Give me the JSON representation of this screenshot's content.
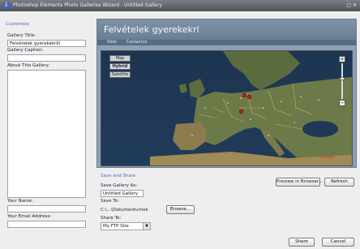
{
  "window": {
    "title": "Photoshop Elements Photo Galleries Wizard - Untitled Gallery"
  },
  "left_panel": {
    "section": "Customize",
    "gallery_title_label": "Gallery Title:",
    "gallery_title_value": "Felvételek gyerekekről",
    "gallery_caption_label": "Gallery Caption:",
    "about_label": "About This Gallery:",
    "your_name_label": "Your Name:",
    "email_label": "Your Email Address:"
  },
  "preview": {
    "gallery_title": "Felvételek gyerekekrl",
    "menu": [
      "View",
      "Contactus"
    ],
    "map_types": [
      "Map",
      "Hybrid",
      "Satellite"
    ]
  },
  "save_share": {
    "section": "Save and Share",
    "save_as_label": "Save Gallery As:",
    "save_as_value": "Untitled Gallery",
    "save_to_label": "Save To:",
    "save_to_value": "C:\\...\\Dokumentumok",
    "browse_button": "Browse...",
    "share_to_label": "Share To:",
    "share_to_value": "My FTP Site"
  },
  "buttons": {
    "preview_in_browser": "Preview in Browser...",
    "refresh": "Refresh",
    "share": "Share",
    "cancel": "Cancel"
  }
}
